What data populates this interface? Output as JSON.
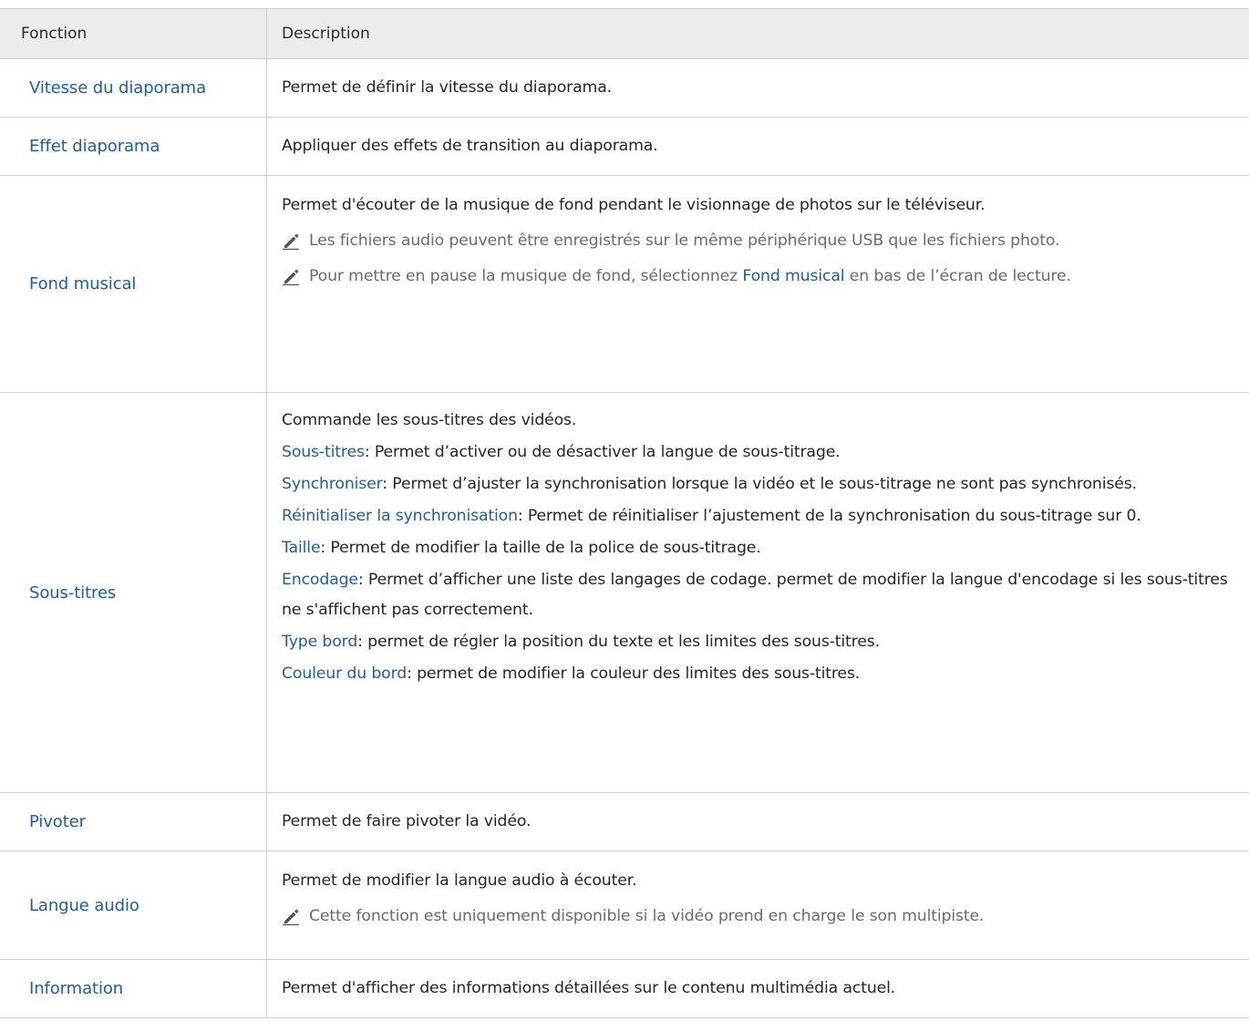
{
  "header": {
    "col1": "Fonction",
    "col2": "Description"
  },
  "rows": {
    "r0": {
      "name": "Vitesse du diaporama",
      "desc": "Permet de définir la vitesse du diaporama."
    },
    "r1": {
      "name": "Effet diaporama",
      "desc": "Appliquer des effets de transition au diaporama."
    },
    "r2": {
      "name": "Fond musical",
      "desc": "Permet d'écouter de la musique de fond pendant le visionnage de photos sur le téléviseur.",
      "note1": "Les fichiers audio peuvent être enregistrés sur le même périphérique USB que les fichiers photo.",
      "note2_pre": "Pour mettre en pause la musique de fond, sélectionnez ",
      "note2_kw": "Fond musical",
      "note2_post": " en bas de l’écran de lecture."
    },
    "r3": {
      "name": "Sous-titres",
      "intro": "Commande les sous-titres des vidéos.",
      "items": [
        {
          "kw": "Sous-titres",
          "text": ": Permet d’activer ou de désactiver la langue de sous-titrage."
        },
        {
          "kw": "Synchroniser",
          "text": ": Permet d’ajuster la synchronisation lorsque la vidéo et le sous-titrage ne sont pas synchronisés."
        },
        {
          "kw": "Réinitialiser la synchronisation",
          "text": ": Permet de réinitialiser l’ajustement de la synchronisation du sous-titrage sur 0."
        },
        {
          "kw": "Taille",
          "text": ": Permet de modifier la taille de la police de sous-titrage."
        },
        {
          "kw": "Encodage",
          "text": ": Permet d’afficher une liste des langages de codage. permet de modifier la langue d'encodage si les sous-titres ne s'affichent pas correctement."
        },
        {
          "kw": "Type bord",
          "text": ": permet de régler la position du texte et les limites des sous-titres."
        },
        {
          "kw": "Couleur du bord",
          "text": ": permet de modifier la couleur des limites des sous-titres."
        }
      ]
    },
    "r4": {
      "name": "Pivoter",
      "desc": "Permet de faire pivoter la vidéo."
    },
    "r5": {
      "name": "Langue audio",
      "desc": "Permet de modifier la langue audio à écouter.",
      "note1": "Cette fonction est uniquement disponible si la vidéo prend en charge le son multipiste."
    },
    "r6": {
      "name": "Information",
      "desc": "Permet d'afficher des informations détaillées sur le contenu multimédia actuel."
    }
  },
  "icons": {
    "note": "pencil-icon"
  },
  "colors": {
    "keyword": "#1a5fa8",
    "header_bg": "#ececec",
    "note_text": "#6b6b6b"
  }
}
